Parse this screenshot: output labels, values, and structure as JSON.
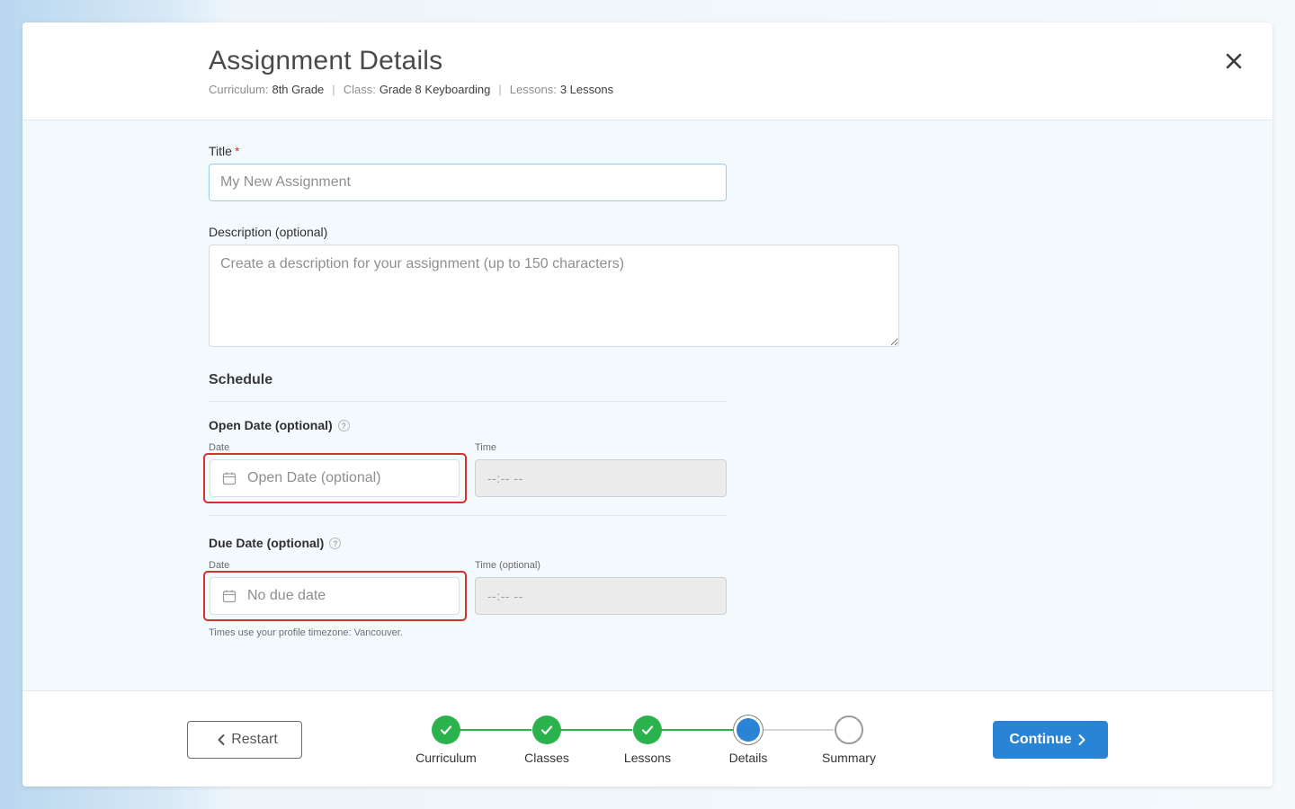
{
  "header": {
    "title": "Assignment Details",
    "meta": [
      {
        "label": "Curriculum:",
        "value": "8th Grade"
      },
      {
        "label": "Class:",
        "value": "Grade 8 Keyboarding"
      },
      {
        "label": "Lessons:",
        "value": "3 Lessons"
      }
    ],
    "separator": "|"
  },
  "form": {
    "title_label": "Title",
    "required_mark": "*",
    "title_placeholder": "My New Assignment",
    "description_label": "Description (optional)",
    "description_placeholder": "Create a description for your assignment (up to 150 characters)",
    "schedule_heading": "Schedule",
    "open_date": {
      "label": "Open Date (optional)",
      "help": "?",
      "date_label": "Date",
      "date_placeholder": "Open Date (optional)",
      "time_label": "Time",
      "time_placeholder": "--:-- --"
    },
    "due_date": {
      "label": "Due Date (optional)",
      "help": "?",
      "date_label": "Date",
      "date_placeholder": "No due date",
      "time_label": "Time (optional)",
      "time_placeholder": "--:-- --"
    },
    "timezone_note": "Times use your profile timezone: Vancouver."
  },
  "footer": {
    "restart_label": "Restart",
    "continue_label": "Continue",
    "steps": [
      {
        "label": "Curriculum",
        "state": "done"
      },
      {
        "label": "Classes",
        "state": "done"
      },
      {
        "label": "Lessons",
        "state": "done"
      },
      {
        "label": "Details",
        "state": "current"
      },
      {
        "label": "Summary",
        "state": "todo"
      }
    ]
  },
  "colors": {
    "accent": "#2a84d6",
    "success": "#2bb24c",
    "highlight": "#d6302b"
  },
  "icons": [
    "close-icon",
    "calendar-icon",
    "help-icon",
    "chevron-left-icon",
    "chevron-right-icon",
    "check-icon"
  ]
}
